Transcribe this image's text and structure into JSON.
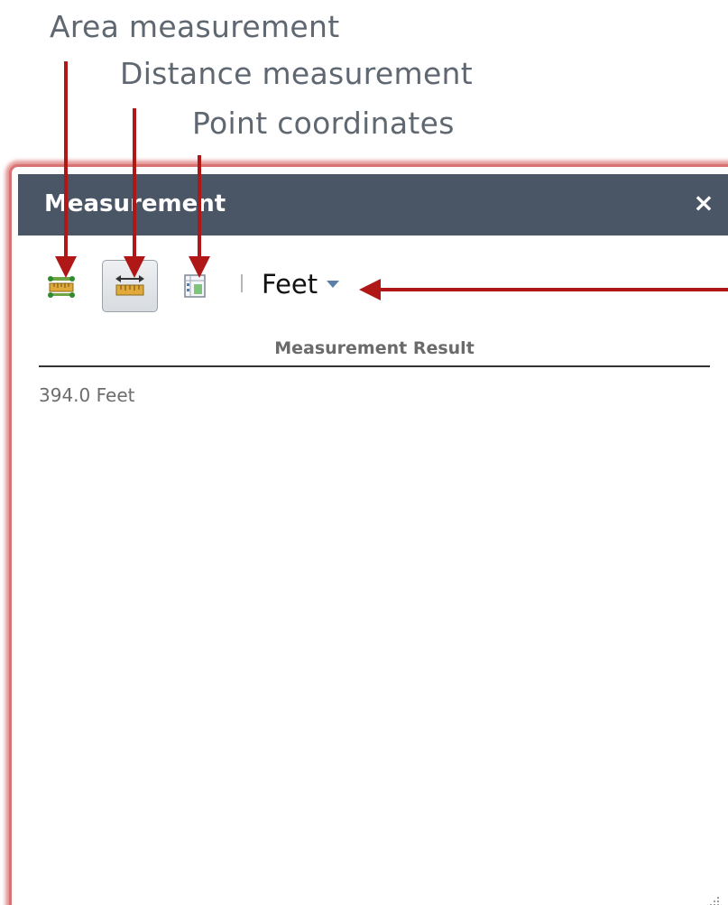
{
  "callouts": {
    "area": "Area measurement",
    "distance": "Distance measurement",
    "point": "Point coordinates"
  },
  "window": {
    "title": "Measurement",
    "close_label": "×"
  },
  "toolbar": {
    "tools": [
      {
        "name": "area",
        "icon": "area-measure-icon",
        "active": false
      },
      {
        "name": "distance",
        "icon": "distance-measure-icon",
        "active": true
      },
      {
        "name": "point",
        "icon": "point-coordinates-icon",
        "active": false
      }
    ],
    "unit": {
      "selected": "Feet",
      "icon": "caret-down-icon"
    }
  },
  "result": {
    "header": "Measurement Result",
    "value": "394.0 Feet"
  },
  "colors": {
    "titlebar": "#4a5565",
    "accent_arrow": "#b01818",
    "caret": "#5b7fa8",
    "panel_glow": "#d87373"
  }
}
